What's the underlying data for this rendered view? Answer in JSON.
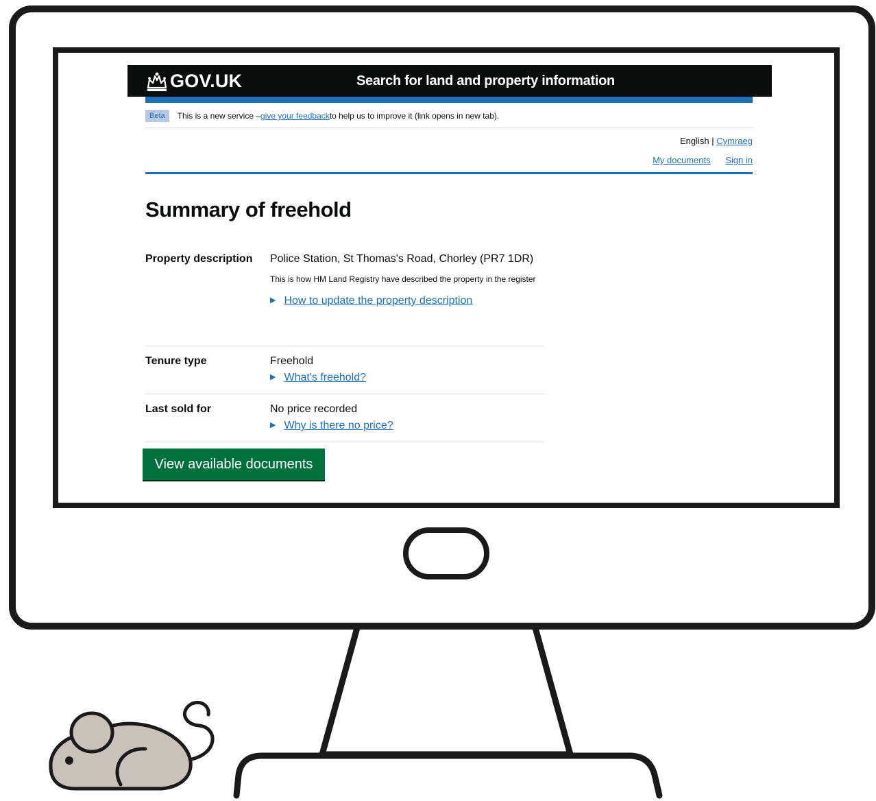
{
  "header": {
    "crown_icon": "crown-icon",
    "logo": "GOV.UK",
    "service_name": "Search for land and property information"
  },
  "beta_banner": {
    "tag": "Beta",
    "text_before": "This is a new service – ",
    "link": "give your feedback",
    "text_after": " to help us to improve it (link opens in new tab)."
  },
  "language": {
    "current": "English",
    "separator": " | ",
    "other": "Cymraeg"
  },
  "account_links": {
    "my_documents": "My documents",
    "sign_in": "Sign in"
  },
  "page_title": "Summary of freehold",
  "summary": {
    "property_description": {
      "key": "Property description",
      "value": "Police Station, St Thomas's Road, Chorley (PR7 1DR)",
      "hint": "This is how HM Land Registry have described the property in the register",
      "details_link": "How to update the property description"
    },
    "tenure_type": {
      "key": "Tenure type",
      "value": "Freehold",
      "details_link": "What's freehold?"
    },
    "last_sold": {
      "key": "Last sold for",
      "value": "No price recorded",
      "details_link": "Why is there no price?"
    }
  },
  "primary_button": "View available documents",
  "details_arrow": "▶",
  "colors": {
    "header_bg": "#0b0c0c",
    "link_blue": "#1d70b8",
    "button_green": "#00703c",
    "mouse_fill": "#c8c2bb"
  }
}
